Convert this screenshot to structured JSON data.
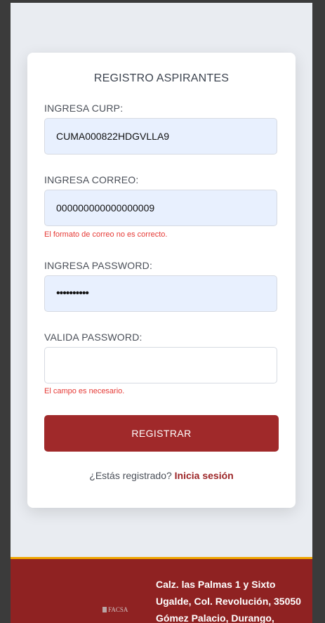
{
  "form": {
    "title": "REGISTRO ASPIRANTES",
    "curp": {
      "label": "INGRESA CURP:",
      "value": "CUMA000822HDGVLLA9"
    },
    "email": {
      "label": "INGRESA CORREO:",
      "value": "000000000000000009",
      "error": "El formato de correo no es correcto."
    },
    "password": {
      "label": "INGRESA PASSWORD:",
      "value_masked": "••••••••••"
    },
    "confirm_password": {
      "label": "VALIDA PASSWORD:",
      "value": "",
      "error": "El campo es necesario."
    },
    "submit_label": "REGISTRAR",
    "login_prompt": "¿Estás registrado?",
    "login_link": "Inicia sesión"
  },
  "footer": {
    "logo_text": "FACSA",
    "address_lines": [
      "Calz. las Palmas 1 y Sixto",
      "Ugalde, Col. Revolución, 35050",
      "Gómez Palacio, Durango,"
    ]
  },
  "colors": {
    "primary": "#a0292a",
    "footer_bg": "#8f2222",
    "footer_accent": "#f0a500",
    "error": "#e53935",
    "autofill_bg": "#e8f0fe"
  }
}
